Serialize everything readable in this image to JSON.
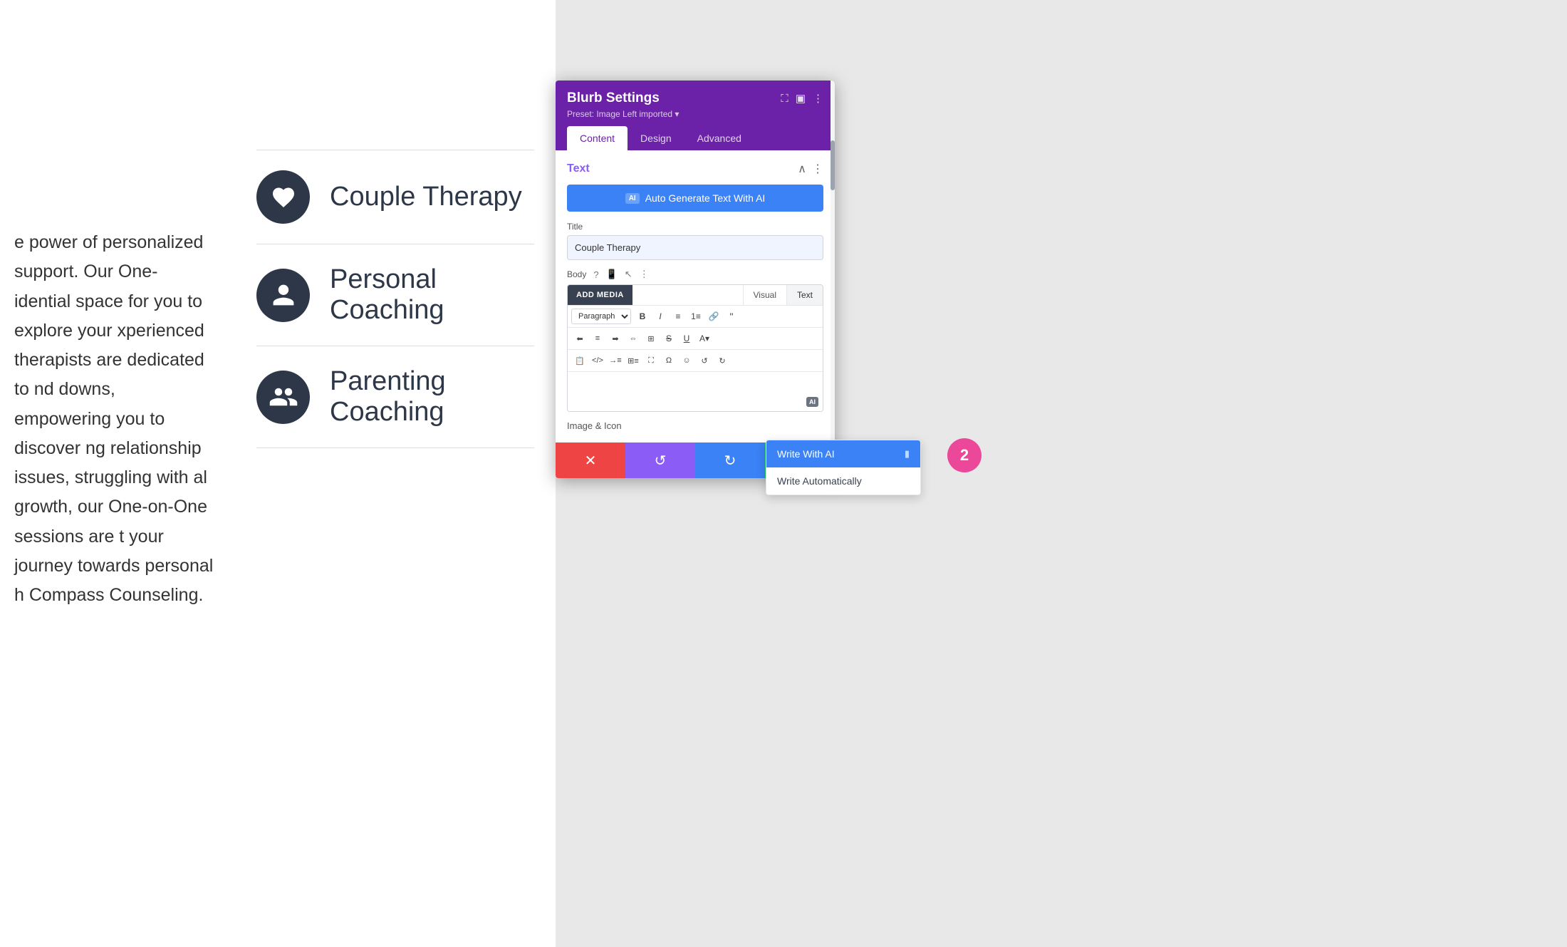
{
  "page": {
    "background_color": "#f0f0f0"
  },
  "left_text": {
    "paragraph": "e power of personalized support. Our One-idential space for you to explore your xperienced therapists are dedicated to nd downs, empowering you to discover ng relationship issues, struggling with al growth, our One-on-One sessions are t your journey towards personal h Compass Counseling."
  },
  "services": [
    {
      "name": "Couple Therapy",
      "icon": "heart"
    },
    {
      "name": "Personal Coaching",
      "icon": "person"
    },
    {
      "name": "Parenting Coaching",
      "icon": "family"
    }
  ],
  "panel": {
    "title": "Blurb Settings",
    "preset": "Preset: Image Left imported ▾",
    "tabs": [
      "Content",
      "Design",
      "Advanced"
    ],
    "active_tab": "Content",
    "text_section": {
      "title": "Text",
      "ai_button_label": "Auto Generate Text With AI",
      "ai_badge": "AI",
      "title_field_label": "Title",
      "title_field_value": "Couple Therapy",
      "body_label": "Body",
      "add_media_btn": "ADD MEDIA",
      "view_tabs": [
        "Visual",
        "Text"
      ],
      "active_view": "Text",
      "paragraph_option": "Paragraph",
      "ai_mini_label": "AI",
      "image_icon_label": "Image & Icon"
    },
    "bottom_bar": {
      "cancel": "✕",
      "undo": "↺",
      "redo": "↻",
      "save": "✓"
    }
  },
  "dropdown": {
    "items": [
      {
        "label": "Write With AI",
        "highlighted": true
      },
      {
        "label": "Write Automatically",
        "highlighted": false
      }
    ]
  },
  "badge": {
    "number": "2"
  },
  "toolbar_buttons": {
    "bold": "B",
    "italic": "I",
    "ul": "≡",
    "ol": "≡",
    "link": "🔗",
    "quote": "❝",
    "align_left": "≡",
    "align_center": "≡",
    "align_right": "≡",
    "align_justify": "≡",
    "table": "⊞",
    "strikethrough": "S",
    "underline": "U",
    "color": "A",
    "paste": "📋",
    "special": "Ω",
    "emoji": "☺",
    "undo_tb": "↺",
    "redo_tb": "↻"
  }
}
